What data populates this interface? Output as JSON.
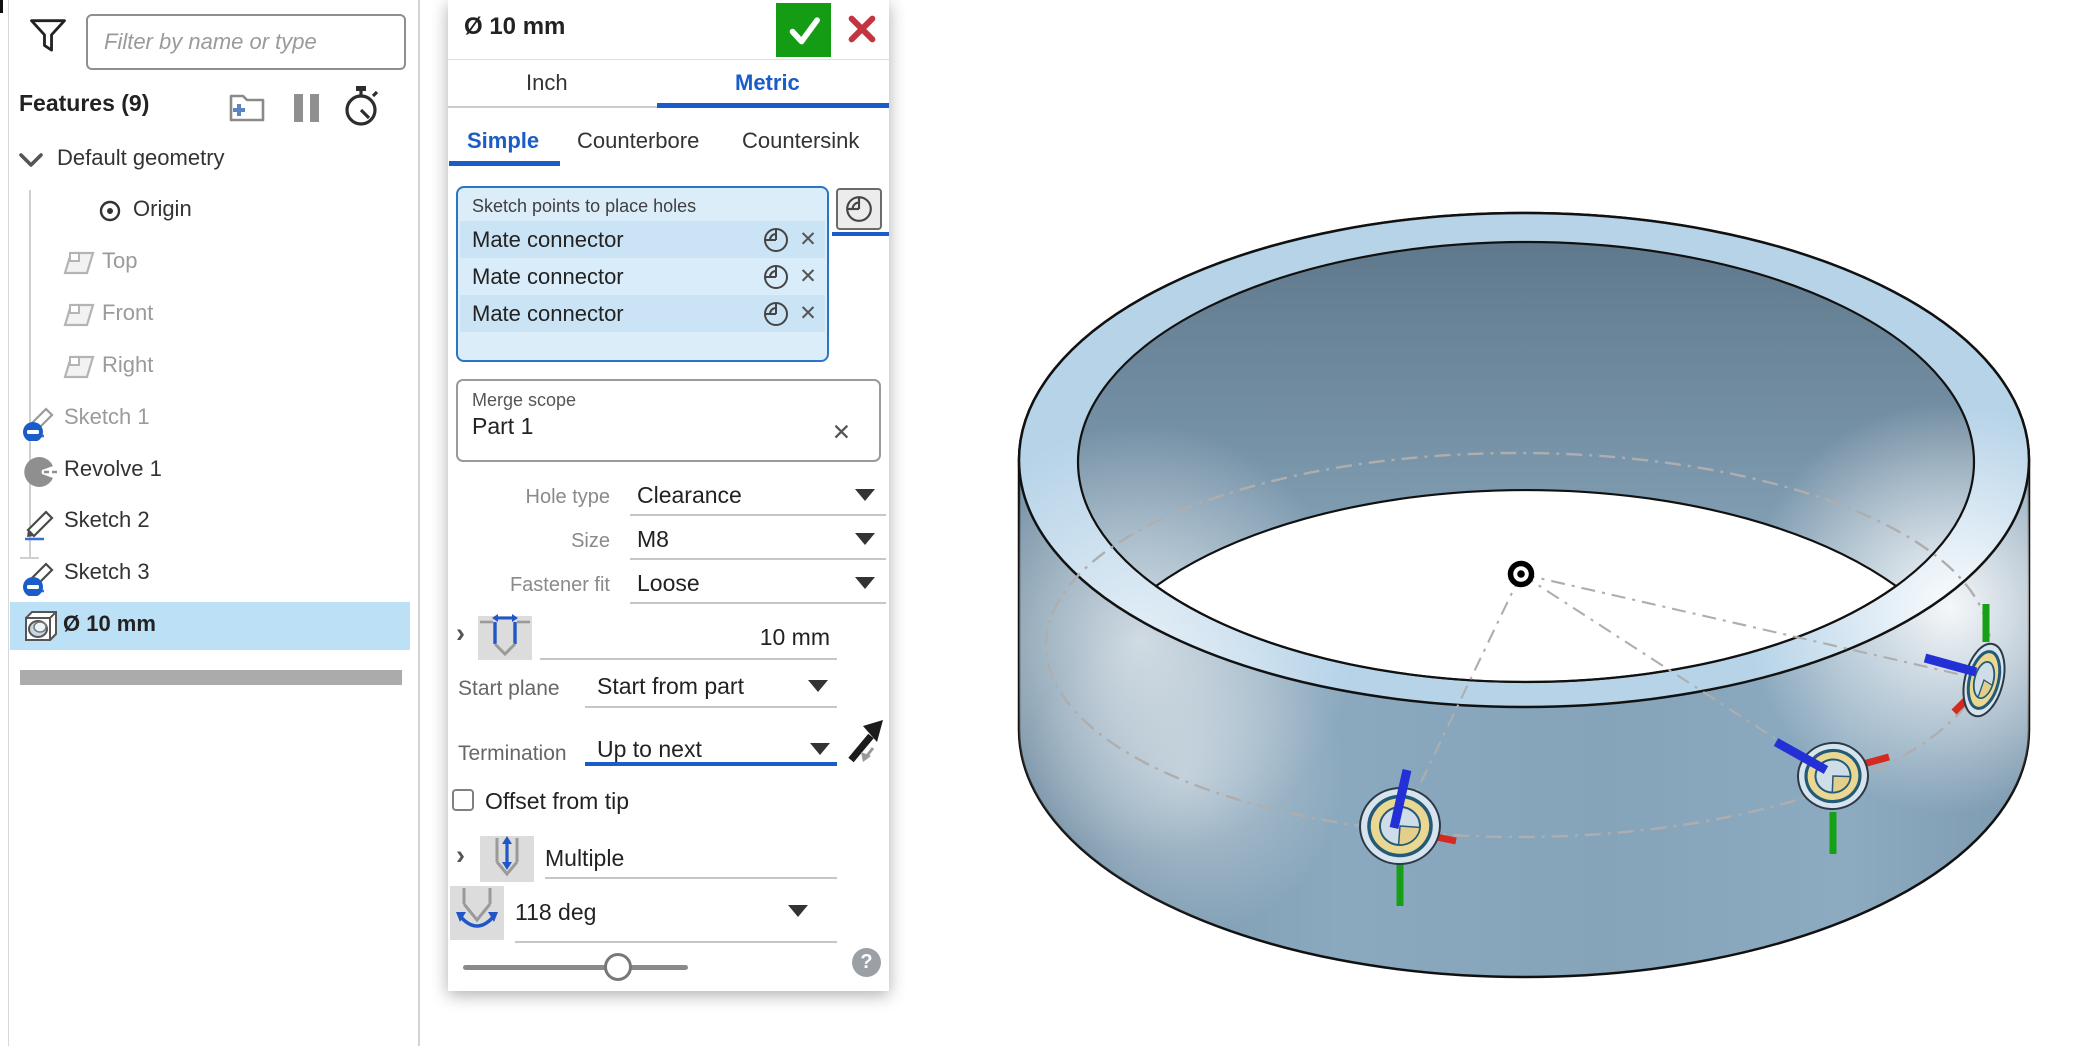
{
  "sidebar": {
    "filter_placeholder": "Filter by name or type",
    "features_header": "Features (9)",
    "toolbar_icons": [
      "filter-funnel-icon",
      "new-folder-icon",
      "suppress-pause-icon",
      "regeneration-timer-icon"
    ],
    "items": [
      {
        "label": "Default geometry"
      },
      {
        "label": "Origin"
      },
      {
        "label": "Top"
      },
      {
        "label": "Front"
      },
      {
        "label": "Right"
      },
      {
        "label": "Sketch 1"
      },
      {
        "label": "Revolve 1"
      },
      {
        "label": "Sketch 2"
      },
      {
        "label": "Sketch 3"
      },
      {
        "label": "Ø 10 mm"
      }
    ]
  },
  "dialog": {
    "title": "Ø 10 mm",
    "unit_tabs": {
      "inch": "Inch",
      "metric": "Metric",
      "active": "Metric"
    },
    "hole_tabs": {
      "simple": "Simple",
      "counterbore": "Counterbore",
      "countersink": "Countersink",
      "active": "Simple"
    },
    "selection": {
      "label": "Sketch points to place holes",
      "rows": [
        {
          "label": "Mate connector",
          "remove": "✕"
        },
        {
          "label": "Mate connector",
          "remove": "✕"
        },
        {
          "label": "Mate connector",
          "remove": "✕"
        }
      ]
    },
    "merge_scope": {
      "label": "Merge scope",
      "value": "Part 1",
      "remove": "✕"
    },
    "hole_type": {
      "label": "Hole type",
      "value": "Clearance"
    },
    "size": {
      "label": "Size",
      "value": "M8"
    },
    "fastener_fit": {
      "label": "Fastener fit",
      "value": "Loose"
    },
    "depth": {
      "value": "10 mm"
    },
    "start_plane": {
      "label": "Start plane",
      "value": "Start from part"
    },
    "termination": {
      "label": "Termination",
      "value": "Up to next"
    },
    "offset_from_tip": {
      "label": "Offset from tip",
      "checked": false
    },
    "multiple": {
      "label": "Multiple"
    },
    "tip_angle": {
      "value": "118 deg"
    },
    "help": "?"
  },
  "viewport": {
    "hole_marker_count": 3,
    "part_color": "#8fb0c7",
    "axis_colors": {
      "x": "#d42a20",
      "y": "#17a017",
      "z": "#2330d6"
    }
  },
  "colors": {
    "accent_blue": "#1a5dc8",
    "confirm_green": "#149c14",
    "cancel_red": "#c43440",
    "selection_bg": "#dcedfa",
    "selection_border": "#2a75c4",
    "highlight_row": "#bce0f5"
  }
}
